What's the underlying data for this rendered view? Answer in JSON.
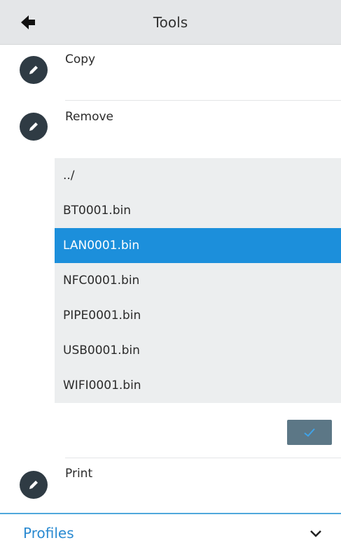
{
  "header": {
    "title": "Tools",
    "back_icon": "arrow-left-icon"
  },
  "tools": [
    {
      "label": "Copy",
      "icon": "pencil-icon"
    },
    {
      "label": "Remove",
      "icon": "pencil-icon"
    },
    {
      "label": "Print",
      "icon": "pencil-icon"
    }
  ],
  "file_list": {
    "items": [
      "../",
      "BT0001.bin",
      "LAN0001.bin",
      "NFC0001.bin",
      "PIPE0001.bin",
      "USB0001.bin",
      "WIFI0001.bin"
    ],
    "selected": "LAN0001.bin"
  },
  "confirm": {
    "icon": "checkmark-icon"
  },
  "footer": {
    "label": "Profiles",
    "icon": "chevron-down-icon"
  },
  "colors": {
    "header_bg": "#e4e6e8",
    "icon_bg": "#2f3b44",
    "list_bg": "#eceeef",
    "selection": "#1c8fdb",
    "confirm_bg": "#5c7786",
    "confirm_check": "#3fa3e8",
    "footer_accent": "#2a8ad1"
  }
}
